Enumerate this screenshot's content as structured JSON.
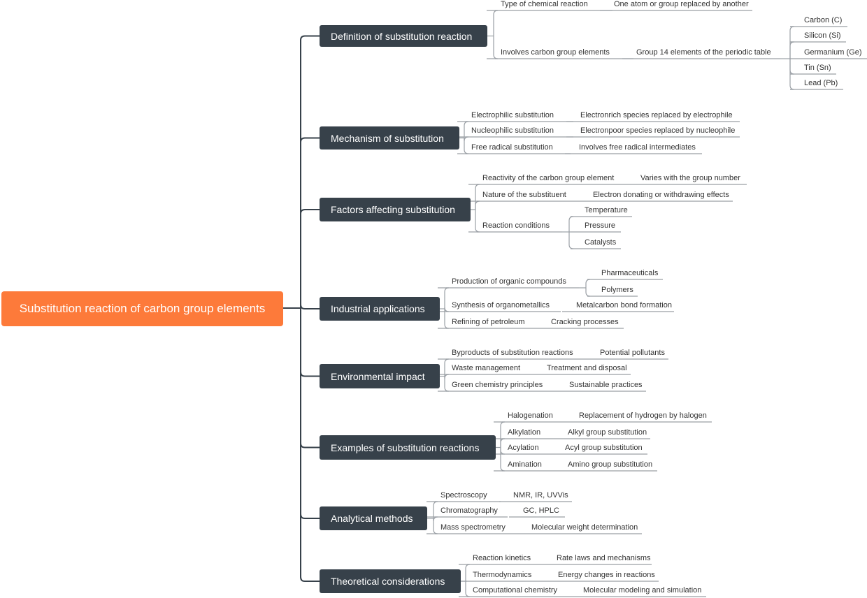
{
  "root": {
    "label": "Substitution reaction of carbon group elements",
    "color": "#fd7a3a"
  },
  "colors": {
    "branch_bg": "#37414a",
    "trunk_line": "#37414a",
    "leaf_line": "#9a9fa5"
  },
  "branches": [
    {
      "label": "Definition of substitution reaction",
      "children": [
        {
          "label": "Type of chemical reaction",
          "children": [
            {
              "label": "One atom or group replaced by another"
            }
          ]
        },
        {
          "label": "Involves carbon group elements",
          "children": [
            {
              "label": "Group 14 elements of the periodic table",
              "children": [
                {
                  "label": "Carbon (C)"
                },
                {
                  "label": "Silicon (Si)"
                },
                {
                  "label": "Germanium (Ge)"
                },
                {
                  "label": "Tin (Sn)"
                },
                {
                  "label": "Lead (Pb)"
                }
              ]
            }
          ]
        }
      ]
    },
    {
      "label": "Mechanism of substitution",
      "children": [
        {
          "label": "Electrophilic substitution",
          "children": [
            {
              "label": "Electronrich species replaced by electrophile"
            }
          ]
        },
        {
          "label": "Nucleophilic substitution",
          "children": [
            {
              "label": "Electronpoor species replaced by nucleophile"
            }
          ]
        },
        {
          "label": "Free radical substitution",
          "children": [
            {
              "label": "Involves free radical intermediates"
            }
          ]
        }
      ]
    },
    {
      "label": "Factors affecting substitution",
      "children": [
        {
          "label": "Reactivity of the carbon group element",
          "children": [
            {
              "label": "Varies with the group number"
            }
          ]
        },
        {
          "label": "Nature of the substituent",
          "children": [
            {
              "label": "Electron donating or withdrawing effects"
            }
          ]
        },
        {
          "label": "Reaction conditions",
          "children": [
            {
              "label": "Temperature"
            },
            {
              "label": "Pressure"
            },
            {
              "label": "Catalysts"
            }
          ]
        }
      ]
    },
    {
      "label": "Industrial applications",
      "children": [
        {
          "label": "Production of organic compounds",
          "children": [
            {
              "label": "Pharmaceuticals"
            },
            {
              "label": "Polymers"
            }
          ]
        },
        {
          "label": "Synthesis of organometallics",
          "children": [
            {
              "label": "Metalcarbon bond formation"
            }
          ]
        },
        {
          "label": "Refining of petroleum",
          "children": [
            {
              "label": "Cracking processes"
            }
          ]
        }
      ]
    },
    {
      "label": "Environmental impact",
      "children": [
        {
          "label": "Byproducts of substitution reactions",
          "children": [
            {
              "label": "Potential pollutants"
            }
          ]
        },
        {
          "label": "Waste management",
          "children": [
            {
              "label": "Treatment and disposal"
            }
          ]
        },
        {
          "label": "Green chemistry principles",
          "children": [
            {
              "label": "Sustainable practices"
            }
          ]
        }
      ]
    },
    {
      "label": "Examples of substitution reactions",
      "children": [
        {
          "label": "Halogenation",
          "children": [
            {
              "label": "Replacement of hydrogen by halogen"
            }
          ]
        },
        {
          "label": "Alkylation",
          "children": [
            {
              "label": "Alkyl group substitution"
            }
          ]
        },
        {
          "label": "Acylation",
          "children": [
            {
              "label": "Acyl group substitution"
            }
          ]
        },
        {
          "label": "Amination",
          "children": [
            {
              "label": "Amino group substitution"
            }
          ]
        }
      ]
    },
    {
      "label": "Analytical methods",
      "children": [
        {
          "label": "Spectroscopy",
          "children": [
            {
              "label": "NMR, IR, UVVis"
            }
          ]
        },
        {
          "label": "Chromatography",
          "children": [
            {
              "label": "GC, HPLC"
            }
          ]
        },
        {
          "label": "Mass spectrometry",
          "children": [
            {
              "label": "Molecular weight determination"
            }
          ]
        }
      ]
    },
    {
      "label": "Theoretical considerations",
      "children": [
        {
          "label": "Reaction kinetics",
          "children": [
            {
              "label": "Rate laws and mechanisms"
            }
          ]
        },
        {
          "label": "Thermodynamics",
          "children": [
            {
              "label": "Energy changes in reactions"
            }
          ]
        },
        {
          "label": "Computational chemistry",
          "children": [
            {
              "label": "Molecular modeling and simulation"
            }
          ]
        }
      ]
    }
  ]
}
